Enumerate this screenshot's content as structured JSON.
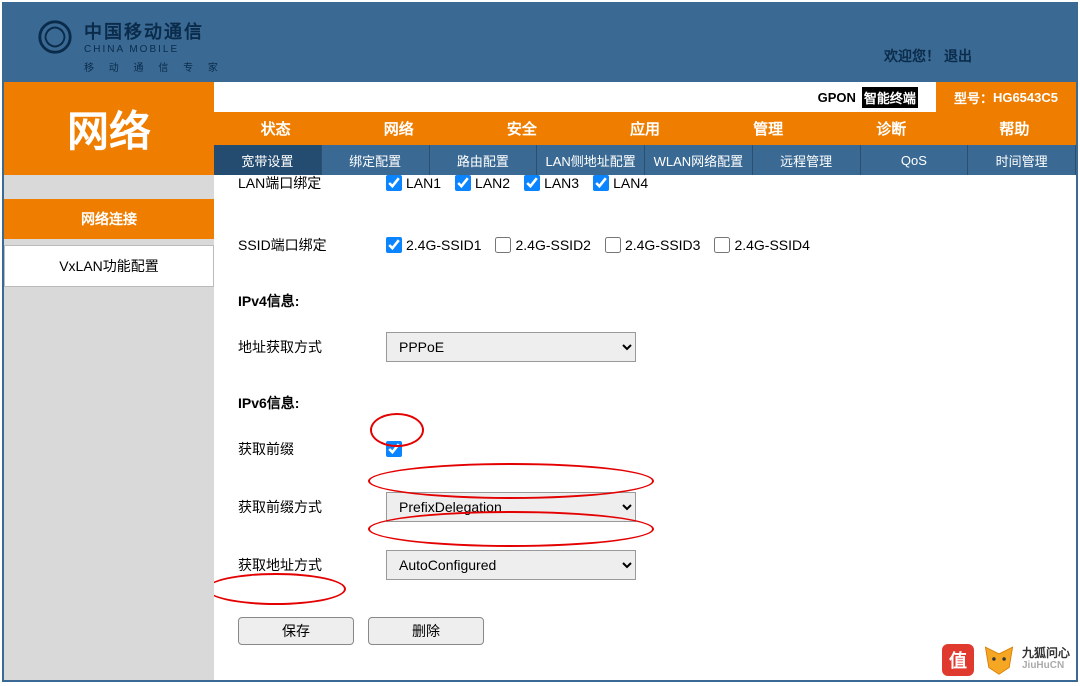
{
  "brand": {
    "cn": "中国移动通信",
    "en": "CHINA MOBILE",
    "sub": "移 动 通 信 专 家"
  },
  "welcome": {
    "text": "欢迎您！",
    "logout": "退出"
  },
  "device": {
    "type_label": "GPON",
    "type_suffix": "智能终端",
    "model_label": "型号：",
    "model": "HG6543C5"
  },
  "title": "网络",
  "main_nav": [
    "状态",
    "网络",
    "安全",
    "应用",
    "管理",
    "诊断",
    "帮助"
  ],
  "main_nav_active": 1,
  "sub_nav": [
    "宽带设置",
    "绑定配置",
    "路由配置",
    "LAN侧地址配置",
    "WLAN网络配置",
    "远程管理",
    "QoS",
    "时间管理"
  ],
  "sub_nav_active": 0,
  "sidebar": {
    "items": [
      "网络连接",
      "VxLAN功能配置"
    ],
    "active": 0
  },
  "form": {
    "lan_bind_label": "LAN端口绑定",
    "lan_ports": [
      "LAN1",
      "LAN2",
      "LAN3",
      "LAN4"
    ],
    "ssid_bind_label": "SSID端口绑定",
    "ssids": [
      "2.4G-SSID1",
      "2.4G-SSID2",
      "2.4G-SSID3",
      "2.4G-SSID4"
    ],
    "ipv4_title": "IPv4信息:",
    "addr_mode_label": "地址获取方式",
    "addr_mode_value": "PPPoE",
    "ipv6_title": "IPv6信息:",
    "get_prefix_label": "获取前缀",
    "prefix_mode_label": "获取前缀方式",
    "prefix_mode_value": "PrefixDelegation",
    "addr_mode6_label": "获取地址方式",
    "addr_mode6_value": "AutoConfigured",
    "save": "保存",
    "delete": "删除"
  },
  "watermark": {
    "cn": "九狐问心",
    "en": "JiuHuCN"
  }
}
